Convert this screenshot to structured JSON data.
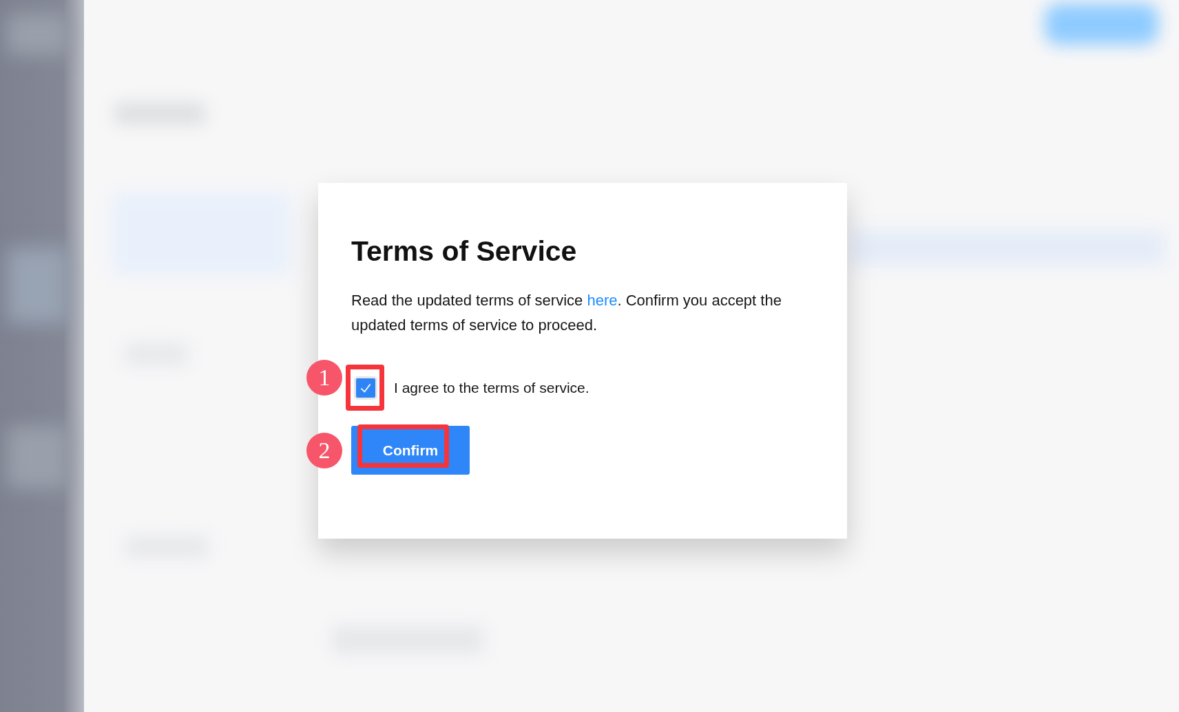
{
  "dialog": {
    "title": "Terms of Service",
    "text_before": "Read the updated terms of service ",
    "link": "here",
    "text_after": ". Confirm you accept the updated terms of service to proceed.",
    "agree": {
      "label": "I agree to the terms of service.",
      "checked": true
    },
    "confirm_button": {
      "label": "Confirm"
    }
  },
  "annotations": [
    {
      "number": "1"
    },
    {
      "number": "2"
    }
  ]
}
